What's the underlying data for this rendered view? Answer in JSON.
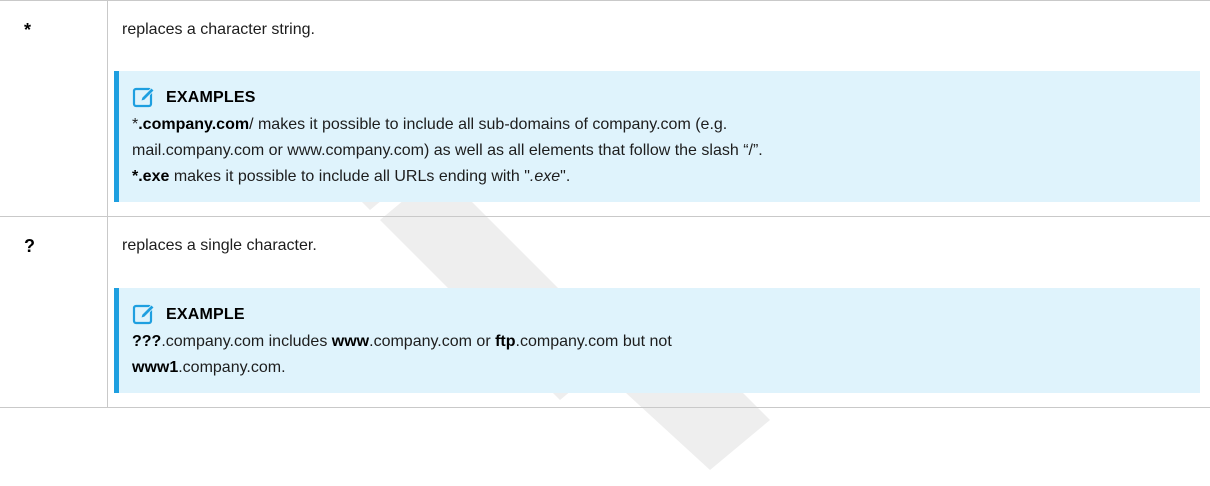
{
  "rows": [
    {
      "symbol": "*",
      "description": "replaces a character string.",
      "note": {
        "title": "EXAMPLES",
        "icon": "pencil-edit-icon",
        "line1": {
          "p1": "*",
          "p2": ".company.com",
          "p3": "/ makes it possible to include all sub-domains of company.com (e.g."
        },
        "line2": "mail.company.com or www.company.com) as well as all elements that follow the slash “/”.",
        "line3": {
          "bold": "*.exe",
          "text": " makes it possible to include all URLs ending with \"",
          "italic": ".exe",
          "end": "\"."
        }
      }
    },
    {
      "symbol": "?",
      "description": "replaces a single character.",
      "note": {
        "title": "EXAMPLE",
        "icon": "pencil-edit-icon",
        "line1": {
          "b1": "???",
          "t1": ".company.com includes ",
          "b2": "www",
          "t2": ".company.com or ",
          "b3": "ftp",
          "t3": ".company.com but not"
        },
        "line2": {
          "b1": "www1",
          "t1": ".company.com."
        }
      }
    }
  ],
  "colors": {
    "note_background": "#dff3fc",
    "note_border": "#1e9fe0",
    "watermark": "#ededed"
  }
}
